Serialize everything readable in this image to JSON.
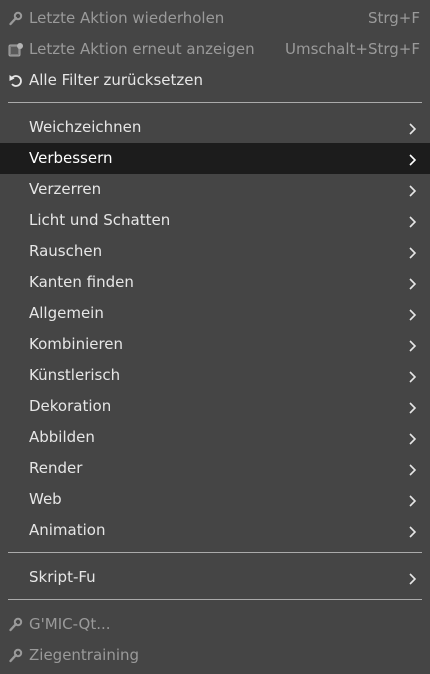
{
  "header_items": [
    {
      "label": "Letzte Aktion wiederholen",
      "shortcut": "Strg+F",
      "icon": "gear-icon",
      "enabled": false
    },
    {
      "label": "Letzte Aktion erneut anzeigen",
      "shortcut": "Umschalt+Strg+F",
      "icon": "filter-dialog-icon",
      "enabled": false
    },
    {
      "label": "Alle Filter zurücksetzen",
      "shortcut": "",
      "icon": "reset-icon",
      "enabled": true
    }
  ],
  "categories": [
    {
      "label": "Weichzeichnen"
    },
    {
      "label": "Verbessern",
      "highlighted": true
    },
    {
      "label": "Verzerren"
    },
    {
      "label": "Licht und Schatten"
    },
    {
      "label": "Rauschen"
    },
    {
      "label": "Kanten finden"
    },
    {
      "label": "Allgemein"
    },
    {
      "label": "Kombinieren"
    },
    {
      "label": "Künstlerisch"
    },
    {
      "label": "Dekoration"
    },
    {
      "label": "Abbilden"
    },
    {
      "label": "Render"
    },
    {
      "label": "Web"
    },
    {
      "label": "Animation"
    }
  ],
  "script_fu": {
    "label": "Skript-Fu"
  },
  "plugins": [
    {
      "label": "G'MIC-Qt...",
      "icon": "gear-icon",
      "enabled": false
    },
    {
      "label": "Ziegentraining",
      "icon": "gear-icon",
      "enabled": false
    }
  ],
  "colors": {
    "menu_background": "#454545",
    "highlight_background": "#1c1c1c",
    "text": "#e6e6e6",
    "disabled_text": "#9a9a9a"
  }
}
